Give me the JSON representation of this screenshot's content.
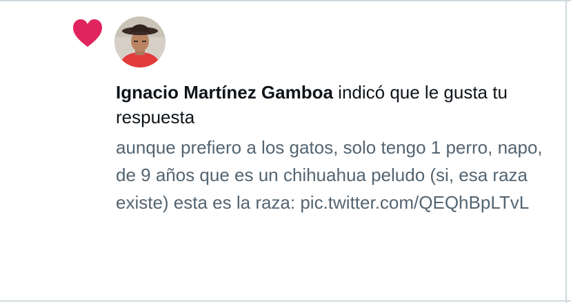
{
  "notification": {
    "icon": "heart-icon",
    "icon_color": "#e0245e",
    "user_name": "Ignacio Martínez Gamboa",
    "action_text": " indicó que le gusta tu respuesta",
    "reply_text": "aunque prefiero a los gatos, solo tengo 1 perro, napo, de 9 años que es un chihuahua peludo (si, esa raza existe) esta es la raza: pic.twitter.com/QEQhBpLTvL"
  }
}
